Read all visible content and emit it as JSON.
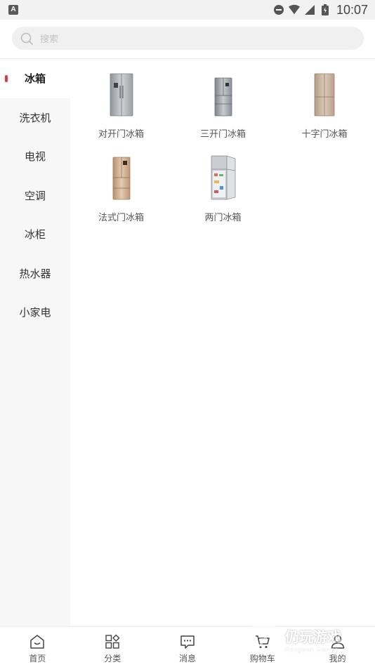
{
  "status_bar": {
    "left_badge": "A",
    "time": "10:07",
    "icons": [
      "dnd-icon",
      "wifi-icon",
      "signal-icon",
      "battery-icon"
    ]
  },
  "search": {
    "placeholder": "搜索"
  },
  "sidebar": {
    "items": [
      {
        "label": "冰箱",
        "active": true
      },
      {
        "label": "洗衣机",
        "active": false
      },
      {
        "label": "电视",
        "active": false
      },
      {
        "label": "空调",
        "active": false
      },
      {
        "label": "冰柜",
        "active": false
      },
      {
        "label": "热水器",
        "active": false
      },
      {
        "label": "小家电",
        "active": false
      }
    ]
  },
  "products": [
    {
      "label": "对开门冰箱",
      "icon": "side-by-side-fridge-image",
      "color": "#a9adb1"
    },
    {
      "label": "三开门冰箱",
      "icon": "three-door-fridge-image",
      "color": "#9aa0a6"
    },
    {
      "label": "十字门冰箱",
      "icon": "cross-door-fridge-image",
      "color": "#c9b39d"
    },
    {
      "label": "法式门冰箱",
      "icon": "french-door-fridge-image",
      "color": "#cfb092"
    },
    {
      "label": "两门冰箱",
      "icon": "two-door-fridge-image",
      "color": "#b8bcc2"
    }
  ],
  "bottom_nav": {
    "items": [
      {
        "label": "首页",
        "icon": "home-icon"
      },
      {
        "label": "分类",
        "icon": "category-icon"
      },
      {
        "label": "消息",
        "icon": "message-icon"
      },
      {
        "label": "购物车",
        "icon": "cart-icon"
      },
      {
        "label": "我的",
        "icon": "profile-icon"
      }
    ]
  },
  "watermark": {
    "main": "仍玩游戏",
    "sub": "Rengwan Games"
  },
  "colors": {
    "accent": "#e23b3b",
    "sidebar_bg": "#f7f7f7",
    "search_bg": "#f0f0f0"
  }
}
